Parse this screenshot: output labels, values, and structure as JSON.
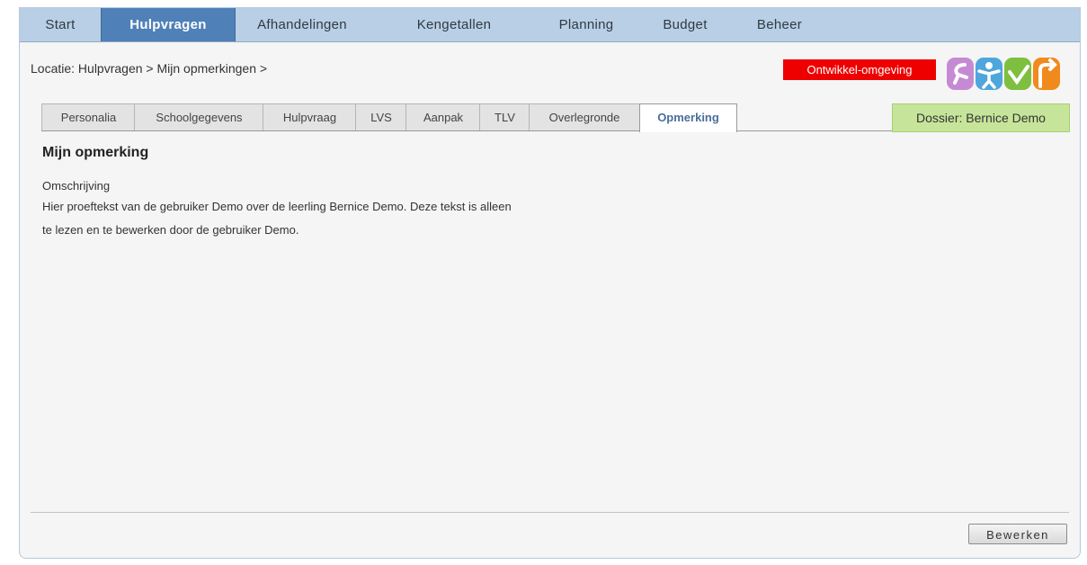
{
  "nav": {
    "items": [
      {
        "label": "Start"
      },
      {
        "label": "Hulpvragen"
      },
      {
        "label": "Afhandelingen"
      },
      {
        "label": "Kengetallen"
      },
      {
        "label": "Planning"
      },
      {
        "label": "Budget"
      },
      {
        "label": "Beheer"
      }
    ],
    "active": "Hulpvragen"
  },
  "location": "Locatie: Hulpvragen > Mijn opmerkingen >",
  "environment_badge": "Ontwikkel-omgeving",
  "tabs": [
    {
      "label": "Personalia"
    },
    {
      "label": "Schoolgegevens"
    },
    {
      "label": "Hulpvraag"
    },
    {
      "label": "LVS"
    },
    {
      "label": "Aanpak"
    },
    {
      "label": "TLV"
    },
    {
      "label": "Overlegronde"
    },
    {
      "label": "Opmerking"
    }
  ],
  "active_tab": "Opmerking",
  "dossier": "Dossier: Bernice Demo",
  "content": {
    "heading": "Mijn opmerking",
    "field_label": "Omschrijving",
    "text_line1": "Hier proeftekst van de gebruiker Demo over de leerling Bernice Demo. Deze tekst is alleen",
    "text_line2": "te lezen en te bewerken door de gebruiker Demo."
  },
  "buttons": {
    "edit": "Bewerken"
  },
  "colors": {
    "nav_bg": "#b9cfe5",
    "nav_active": "#4f81b8",
    "env_badge": "#ee0000",
    "dossier_bg": "#c6e59a"
  },
  "logo_icons": [
    "person-icon",
    "child-icon",
    "checkmark-icon",
    "arrow-icon"
  ]
}
